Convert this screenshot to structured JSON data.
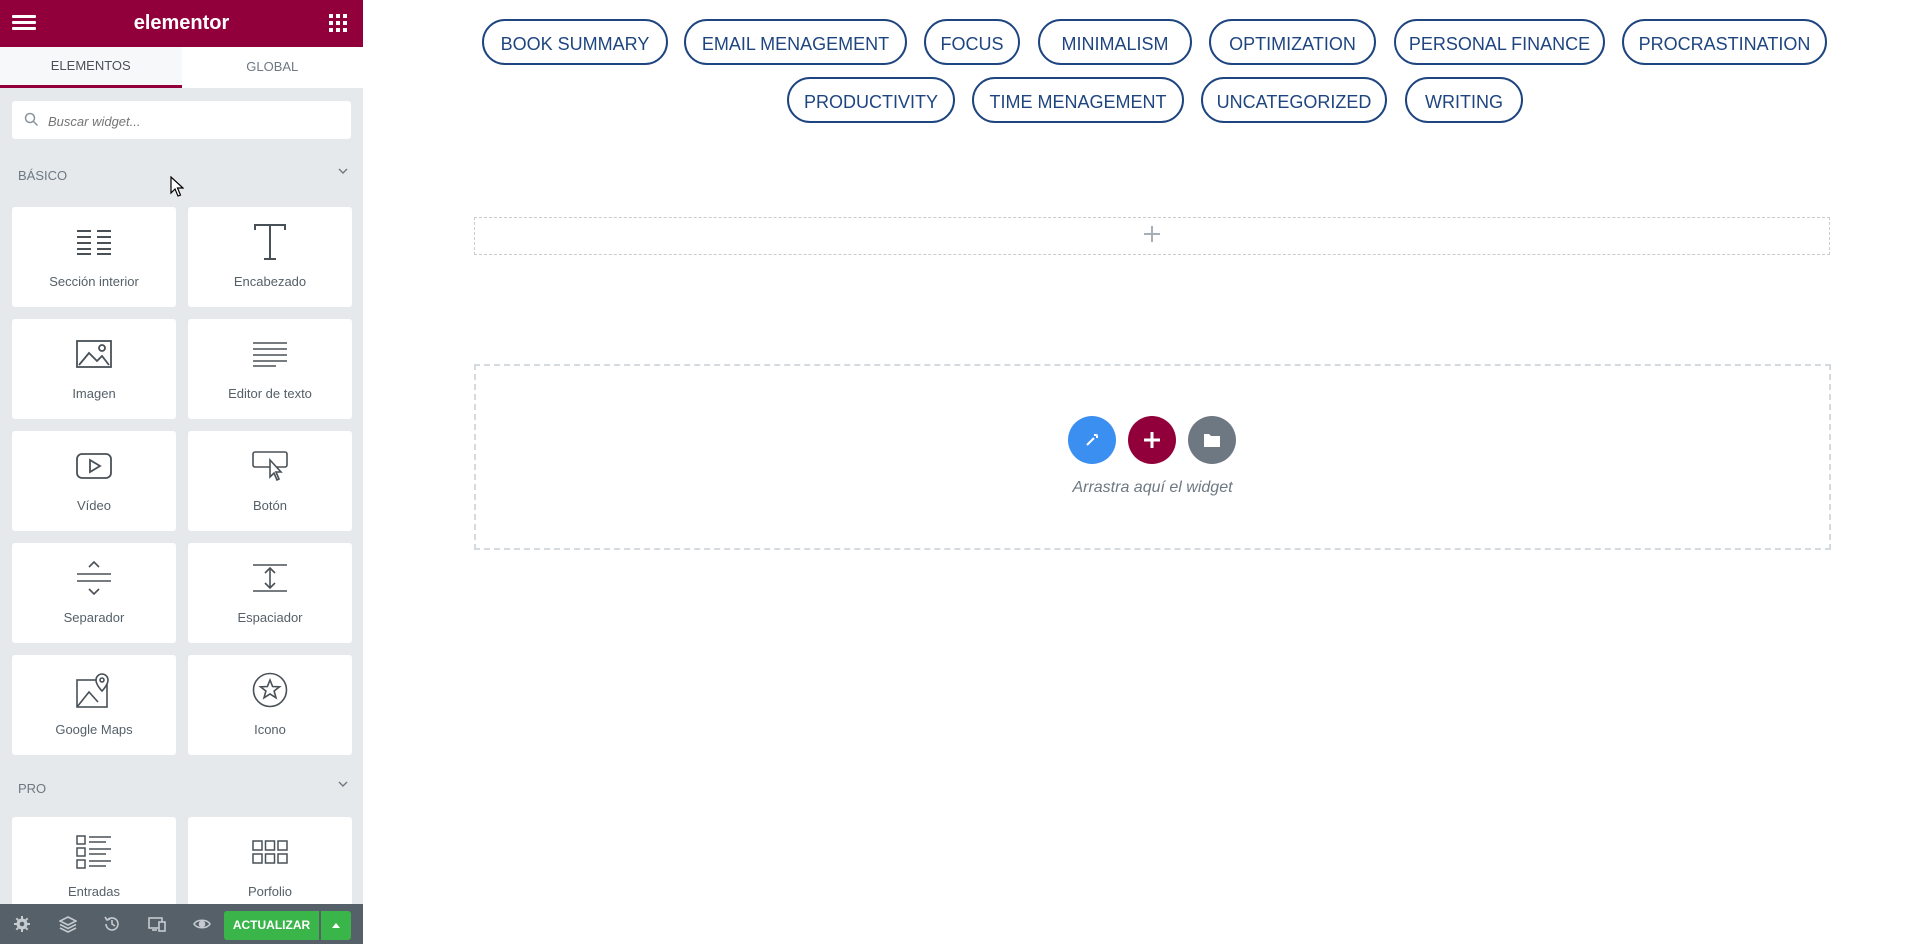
{
  "panel": {
    "logo": "elementor",
    "tabs": [
      {
        "label": "ELEMENTOS"
      },
      {
        "label": "GLOBAL"
      }
    ],
    "search_placeholder": "Buscar widget...",
    "categories": [
      {
        "title": "BÁSICO",
        "widgets": [
          {
            "label": "Sección interior",
            "icon": "inner-section-icon"
          },
          {
            "label": "Encabezado",
            "icon": "heading-icon"
          },
          {
            "label": "Imagen",
            "icon": "image-icon"
          },
          {
            "label": "Editor de texto",
            "icon": "text-editor-icon"
          },
          {
            "label": "Vídeo",
            "icon": "video-icon"
          },
          {
            "label": "Botón",
            "icon": "button-icon"
          },
          {
            "label": "Separador",
            "icon": "divider-icon"
          },
          {
            "label": "Espaciador",
            "icon": "spacer-icon"
          },
          {
            "label": "Google Maps",
            "icon": "google-maps-icon"
          },
          {
            "label": "Icono",
            "icon": "star-icon"
          }
        ]
      },
      {
        "title": "PRO",
        "widgets": [
          {
            "label": "Entradas",
            "icon": "posts-icon"
          },
          {
            "label": "Porfolio",
            "icon": "portfolio-icon"
          }
        ]
      }
    ],
    "footer": {
      "update_label": "ACTUALIZAR"
    }
  },
  "preview": {
    "tags": [
      "BOOK SUMMARY",
      "EMAIL MENAGEMENT",
      "FOCUS",
      "MINIMALISM",
      "OPTIMIZATION",
      "PERSONAL FINANCE",
      "PROCRASTINATION",
      "PRODUCTIVITY",
      "TIME MENAGEMENT",
      "UNCATEGORIZED",
      "WRITING"
    ],
    "dropzone_text": "Arrastra aquí el widget"
  },
  "colors": {
    "brand": "#92003b",
    "tag_color": "#1e4580",
    "update_green": "#39b54a",
    "ai_blue": "#3b8ff0",
    "template_gray": "#6d7882"
  }
}
